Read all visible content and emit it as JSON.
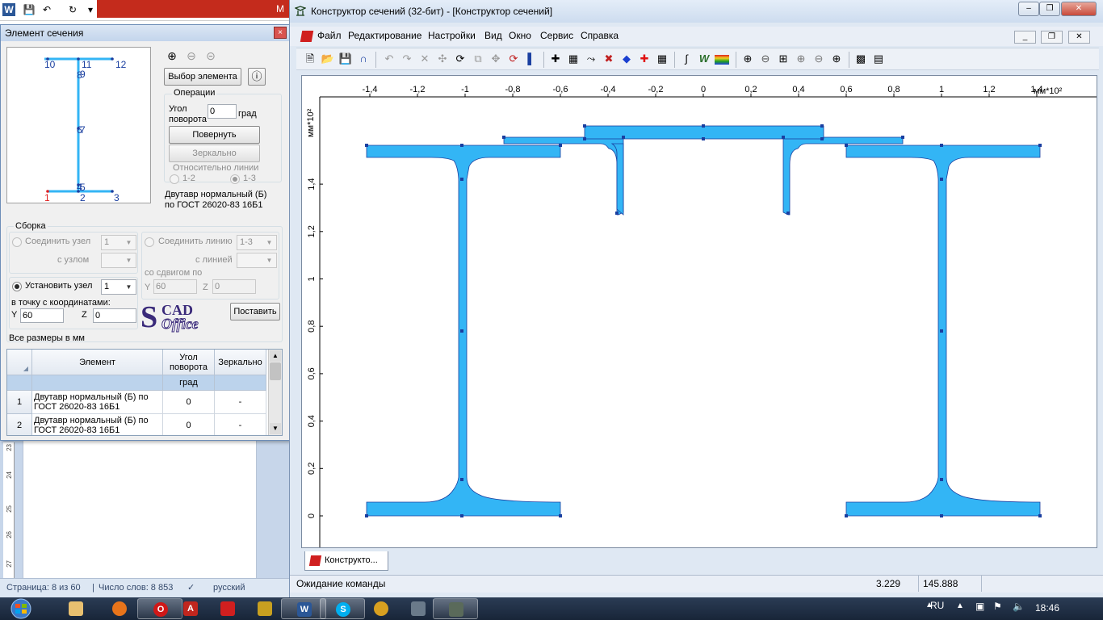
{
  "word": {
    "title_partial": "M",
    "status": {
      "page": "Страница: 8 из 60",
      "words": "Число слов: 8 853",
      "language": "русский"
    },
    "ruler": [
      "23",
      "24",
      "25",
      "26",
      "27"
    ]
  },
  "dialog": {
    "title": "Элемент сечения",
    "close": "×",
    "preview_labels": [
      "10",
      "11",
      "12",
      "9",
      "8",
      "7",
      "6",
      "5",
      "4",
      "1",
      "2",
      "3"
    ],
    "choose_element_button": "Выбор элемента",
    "operations": {
      "legend": "Операции",
      "angle_label_1": "Угол",
      "angle_label_2": "поворота",
      "angle_value": "0",
      "angle_unit": "град",
      "rotate_button": "Повернуть",
      "mirror_button": "Зеркально",
      "relative_line_label": "Относительно линии",
      "option_12": "1-2",
      "option_13": "1-3"
    },
    "element_name_1": "Двутавр нормальный (Б)",
    "element_name_2": "по ГОСТ 26020-83  16Б1",
    "assembly": {
      "legend": "Сборка",
      "join_node": "Соединить узел",
      "join_node_value": "1",
      "with_node": "с узлом",
      "with_node_value": "",
      "join_line": "Соединить линию",
      "join_line_value": "1-3",
      "with_line": "с линией",
      "with_line_value": "",
      "with_shift": "со сдвигом по",
      "y_label": "Y",
      "y_shift_value": "60",
      "z_label": "Z",
      "z_shift_value": "0",
      "set_node": "Установить узел",
      "set_node_value": "1",
      "to_point": "в точку с координатами:",
      "y_value": "60",
      "z_value": "0",
      "place_button": "Поставить"
    },
    "logo_top": "CAD",
    "logo_bottom": "Office",
    "all_sizes": "Все размеры в мм",
    "table": {
      "headers": [
        "Элемент",
        "Угол поворота",
        "Зеркально"
      ],
      "units": [
        "",
        "град",
        ""
      ],
      "rows": [
        {
          "num": "1",
          "element": "Двутавр нормальный (Б) по ГОСТ 26020-83  16Б1",
          "angle": "0",
          "mirror": "-"
        },
        {
          "num": "2",
          "element": "Двутавр нормальный (Б) по ГОСТ 26020-83  16Б1",
          "angle": "0",
          "mirror": "-"
        }
      ]
    }
  },
  "main": {
    "title": "Конструктор сечений (32-бит) - [Конструктор сечений]",
    "menu": [
      "Файл",
      "Редактирование",
      "Настройки",
      "Вид",
      "Окно",
      "Сервис",
      "Справка"
    ],
    "x_ticks": [
      "-1,4",
      "-1,2",
      "-1",
      "-0,8",
      "-0,6",
      "-0,4",
      "-0,2",
      "0",
      "0,2",
      "0,4",
      "0,6",
      "0,8",
      "1",
      "1,2",
      "1,4"
    ],
    "x_unit": "мм*10²",
    "y_ticks": [
      "1,4",
      "1,2",
      "1",
      "0,8",
      "0,6",
      "0,4",
      "0,2",
      "0"
    ],
    "y_unit": "мм*10²",
    "tab": "Конструкто...",
    "status": {
      "text": "Ожидание команды",
      "coord_y": "3.229",
      "coord_z": "145.888"
    },
    "shape_color": "#33b5f5",
    "outline_color": "#1a3fa0"
  },
  "taskbar": {
    "lang": "RU",
    "time": "18:46"
  }
}
